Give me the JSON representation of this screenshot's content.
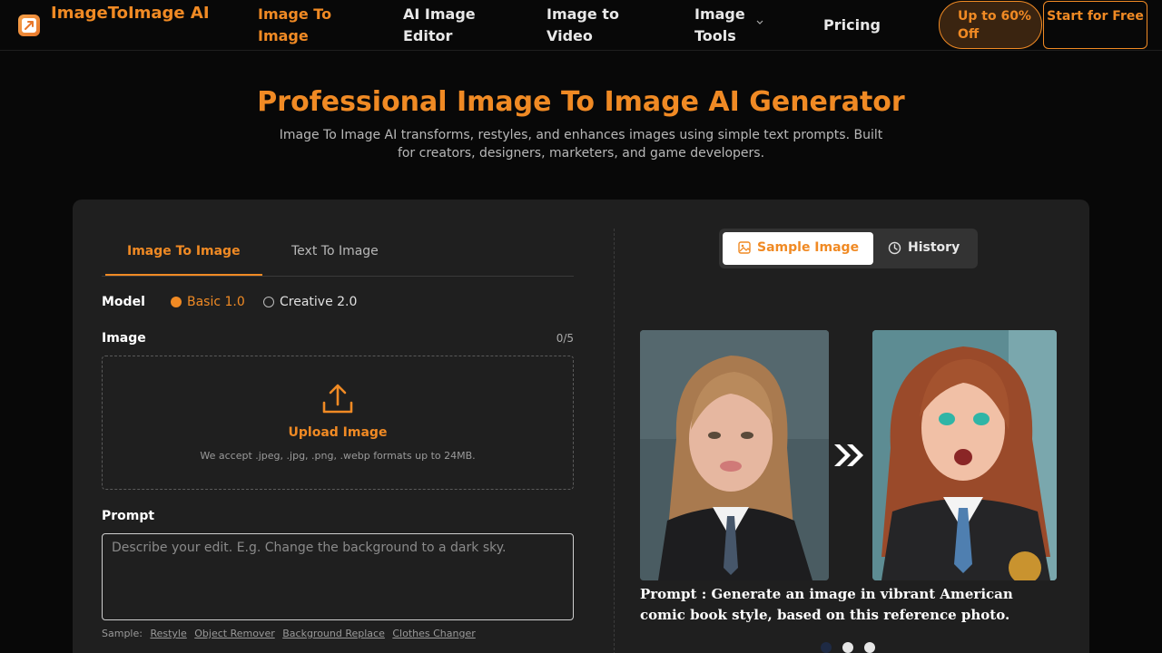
{
  "nav": {
    "brand": "ImageToImage AI",
    "items": [
      {
        "label": "Image To Image"
      },
      {
        "label": "AI Image Editor"
      },
      {
        "label": "Image to Video"
      },
      {
        "label": "Image Tools"
      },
      {
        "label": "Pricing"
      }
    ],
    "promo_label": "Up to 60% Off",
    "cta_label": "Start for Free"
  },
  "hero": {
    "title": "Professional Image To Image AI Generator",
    "subtitle": "Image To Image AI transforms, restyles, and enhances images using simple text prompts. Built for creators, designers, marketers, and game developers."
  },
  "editor": {
    "tabs": [
      "Image To Image",
      "Text To Image"
    ],
    "active_tab": "Image To Image",
    "model_label": "Model",
    "models": [
      "Basic 1.0",
      "Creative 2.0"
    ],
    "selected_model": "Basic 1.0",
    "image_label": "Image",
    "image_count": "0/5",
    "upload_label": "Upload Image",
    "upload_hint": "We accept .jpeg, .jpg, .png, .webp formats up to 24MB.",
    "prompt_label": "Prompt",
    "prompt_placeholder": "Describe your edit. E.g. Change the background to a dark sky.",
    "prompt_value": "",
    "samples_label": "Sample:",
    "samples": [
      "Restyle",
      "Object Remover",
      "Background Replace",
      "Clothes Changer"
    ]
  },
  "preview": {
    "tabs": [
      "Sample Image",
      "History"
    ],
    "active_tab": "Sample Image",
    "caption": "Prompt : Generate an image in vibrant American comic book style, based on this reference photo.",
    "carousel_slides": 3,
    "carousel_active_index": 0
  },
  "colors": {
    "accent": "#f08a24",
    "background": "#080808",
    "panel": "#1f1f1f",
    "dot_active": "#1e2a44",
    "dot_inactive": "#e6e6e6"
  },
  "icons": [
    "logo-icon",
    "chevron-down-icon",
    "upload-icon",
    "image-icon",
    "clock-icon",
    "double-chevron-right-icon"
  ]
}
